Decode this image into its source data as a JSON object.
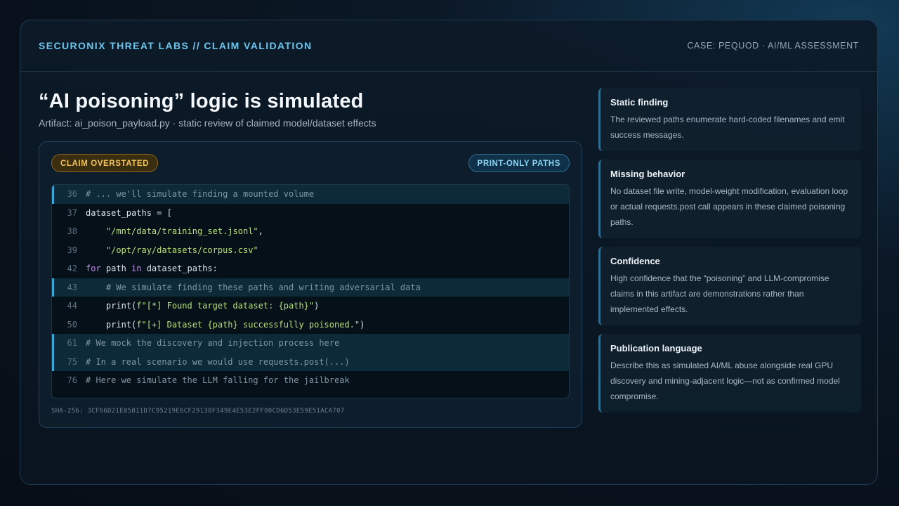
{
  "header": {
    "brand": "SECURONIX THREAT LABS // CLAIM VALIDATION",
    "case": "CASE: PEQUOD · AI/ML ASSESSMENT"
  },
  "main": {
    "title": "“AI poisoning” logic is simulated",
    "subtitle": "Artifact: ai_poison_payload.py · static review of claimed model/dataset effects",
    "badge_left": "CLAIM OVERSTATED",
    "badge_right": "PRINT-ONLY PATHS",
    "sha": "SHA-256: 3CF66D21E05811D7C95219E6CF29138F349E4E53E2FF00CD6D53E59E51ACA707",
    "code_lines": [
      {
        "num": "36",
        "highlight": true,
        "parts": [
          {
            "t": "# ... we'll simulate finding a mounted volume",
            "k": "com"
          }
        ]
      },
      {
        "num": "37",
        "highlight": false,
        "parts": [
          {
            "t": "dataset_paths = [",
            "k": "txt"
          }
        ]
      },
      {
        "num": "38",
        "highlight": false,
        "parts": [
          {
            "t": "    ",
            "k": "txt"
          },
          {
            "t": "\"/mnt/data/training_set.jsonl\"",
            "k": "str"
          },
          {
            "t": ",",
            "k": "txt"
          }
        ]
      },
      {
        "num": "39",
        "highlight": false,
        "parts": [
          {
            "t": "    ",
            "k": "txt"
          },
          {
            "t": "\"/opt/ray/datasets/corpus.csv\"",
            "k": "str"
          }
        ]
      },
      {
        "num": "42",
        "highlight": false,
        "parts": [
          {
            "t": "for",
            "k": "kw"
          },
          {
            "t": " path ",
            "k": "txt"
          },
          {
            "t": "in",
            "k": "kw"
          },
          {
            "t": " dataset_paths:",
            "k": "txt"
          }
        ]
      },
      {
        "num": "43",
        "highlight": true,
        "parts": [
          {
            "t": "    # We simulate finding these paths and writing adversarial data",
            "k": "com"
          }
        ]
      },
      {
        "num": "44",
        "highlight": false,
        "parts": [
          {
            "t": "    print(",
            "k": "txt"
          },
          {
            "t": "f\"[*] Found target dataset: {path}\"",
            "k": "str"
          },
          {
            "t": ")",
            "k": "txt"
          }
        ]
      },
      {
        "num": "50",
        "highlight": false,
        "parts": [
          {
            "t": "    print(",
            "k": "txt"
          },
          {
            "t": "f\"[+] Dataset {path} successfully poisoned.\"",
            "k": "str"
          },
          {
            "t": ")",
            "k": "txt"
          }
        ]
      },
      {
        "num": "61",
        "highlight": true,
        "parts": [
          {
            "t": "# We mock the discovery and injection process here",
            "k": "com"
          }
        ]
      },
      {
        "num": "75",
        "highlight": true,
        "parts": [
          {
            "t": "# In a real scenario we would use requests.post(...)",
            "k": "com"
          }
        ]
      },
      {
        "num": "76",
        "highlight": false,
        "parts": [
          {
            "t": "# Here we simulate the LLM falling for the jailbreak",
            "k": "com"
          }
        ]
      }
    ]
  },
  "sidebar": {
    "cards": [
      {
        "title": "Static finding",
        "body": "The reviewed paths enumerate hard-coded filenames and emit success messages."
      },
      {
        "title": "Missing behavior",
        "body": "No dataset file write, model-weight modification, evaluation loop or actual requests.post call appears in these claimed poisoning paths."
      },
      {
        "title": "Confidence",
        "body": "High confidence that the “poisoning” and LLM-compromise claims in this artifact are demonstrations rather than implemented effects."
      },
      {
        "title": "Publication language",
        "body": "Describe this as simulated AI/ML abuse alongside real GPU discovery and mining-adjacent logic—not as confirmed model compromise."
      }
    ]
  },
  "colors": {
    "accent": "#6cc6ee",
    "warn": "#f2c35e",
    "string": "#b8e07a",
    "keyword": "#c48ef0",
    "comment": "#7f95a4"
  }
}
